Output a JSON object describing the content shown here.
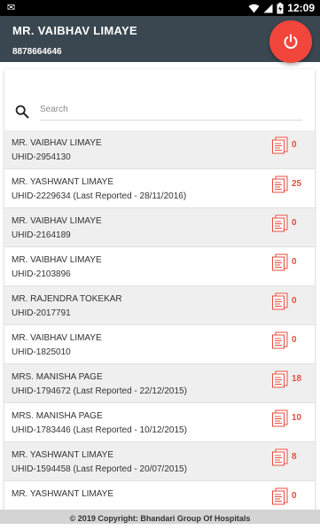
{
  "statusbar": {
    "time": "12:09",
    "icons": [
      "notification-icon",
      "wifi-icon",
      "signal-icon",
      "battery-icon"
    ]
  },
  "header": {
    "name": "MR. VAIBHAV LIMAYE",
    "phone": "8878664646",
    "power_icon": "power-icon",
    "accent": "#f2463c",
    "background": "#3a4750"
  },
  "search": {
    "placeholder": "Search",
    "value": ""
  },
  "patients": [
    {
      "name": "MR. VAIBHAV LIMAYE",
      "uhid": "UHID-2954130",
      "count": "0"
    },
    {
      "name": "MR. YASHWANT LIMAYE",
      "uhid": "UHID-2229634 (Last Reported - 28/11/2016)",
      "count": "25"
    },
    {
      "name": "MR. VAIBHAV LIMAYE",
      "uhid": "UHID-2164189",
      "count": "0"
    },
    {
      "name": "MR. VAIBHAV LIMAYE",
      "uhid": "UHID-2103896",
      "count": "0"
    },
    {
      "name": "MR. RAJENDRA TOKEKAR",
      "uhid": "UHID-2017791",
      "count": "0"
    },
    {
      "name": "MR. VAIBHAV LIMAYE",
      "uhid": "UHID-1825010",
      "count": "0"
    },
    {
      "name": "MRS. MANISHA PAGE",
      "uhid": "UHID-1794672 (Last Reported - 22/12/2015)",
      "count": "18"
    },
    {
      "name": "MRS. MANISHA PAGE",
      "uhid": "UHID-1783446 (Last Reported - 10/12/2015)",
      "count": "10"
    },
    {
      "name": "MR. YASHWANT LIMAYE",
      "uhid": "UHID-1594458 (Last Reported - 20/07/2015)",
      "count": "8"
    },
    {
      "name": "MR. YASHWANT LIMAYE",
      "uhid": "",
      "count": "0"
    }
  ],
  "footer": {
    "copyright": "© 2019 Copyright: Bhandari Group Of Hospitals"
  }
}
